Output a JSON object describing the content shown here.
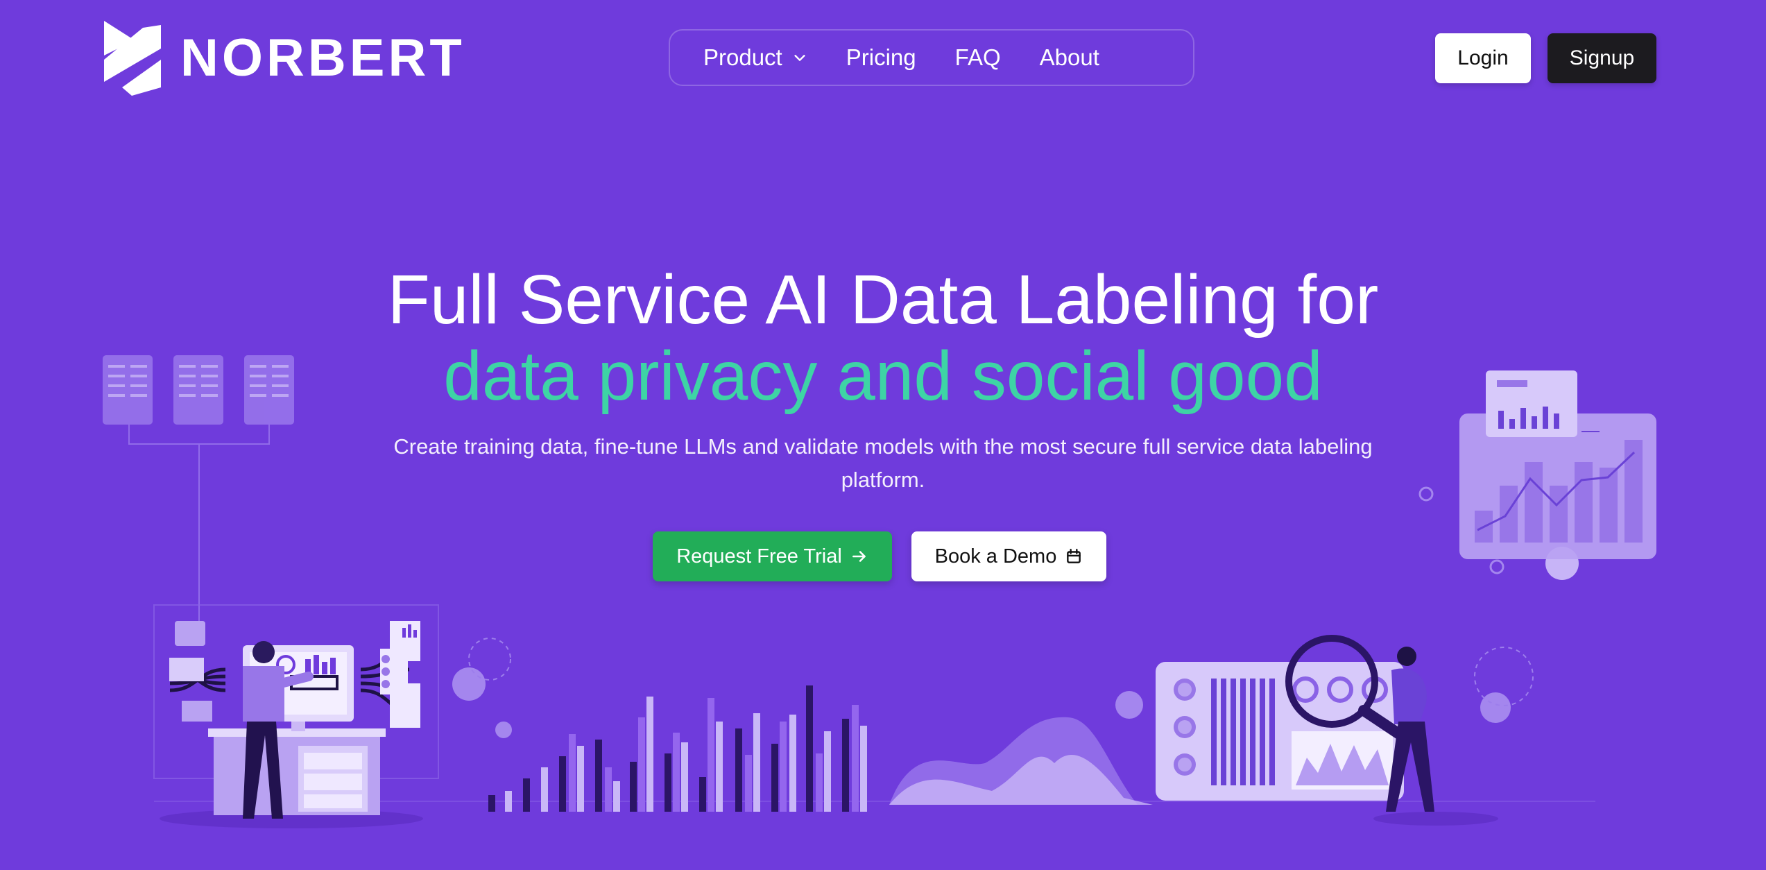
{
  "brand": {
    "name": "NORBERT"
  },
  "nav": {
    "items": [
      {
        "label": "Product",
        "has_dropdown": true
      },
      {
        "label": "Pricing"
      },
      {
        "label": "FAQ"
      },
      {
        "label": "About"
      }
    ]
  },
  "auth": {
    "login_label": "Login",
    "signup_label": "Signup"
  },
  "hero": {
    "title_line1": "Full Service AI Data Labeling for",
    "title_line2": "data privacy and social good",
    "subtitle": "Create training data, fine-tune LLMs and validate models with the most secure full service data labeling platform.",
    "primary_cta": "Request Free Trial",
    "secondary_cta": "Book a Demo"
  },
  "icons": {
    "dropdown": "chevron-down-icon",
    "primary_cta": "arrow-right-icon",
    "secondary_cta": "calendar-icon"
  },
  "colors": {
    "background": "#6f3bdc",
    "accent_text": "#3ed4a5",
    "primary_cta": "#22ad58",
    "signup_bg": "#1c1b1f"
  }
}
